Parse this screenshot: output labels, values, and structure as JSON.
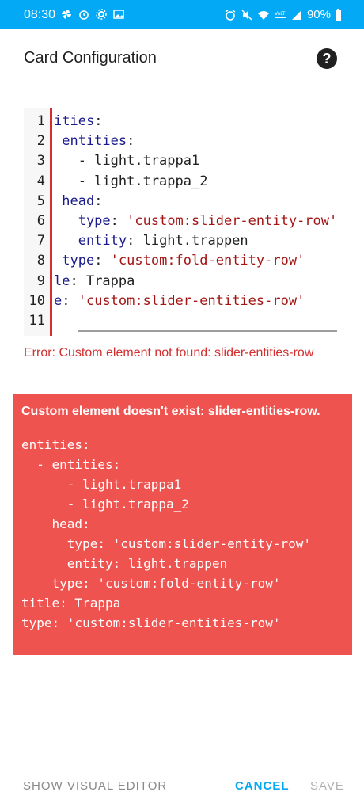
{
  "statusbar": {
    "time": "08:30",
    "battery": "90%",
    "icons_left": [
      "pinwheel-icon",
      "alarm-clock-icon",
      "gear-icon",
      "image-icon"
    ],
    "icons_right": [
      "alarm-icon",
      "mute-icon",
      "wifi-icon",
      "volte-icon",
      "signal-icon",
      "battery-icon"
    ]
  },
  "dialog": {
    "title": "Card Configuration",
    "help_icon": "?"
  },
  "editor": {
    "line_numbers": [
      "1",
      "2",
      "3",
      "4",
      "5",
      "6",
      "7",
      "8",
      "9",
      "10",
      "11"
    ],
    "lines": [
      [
        {
          "t": "ities",
          "c": "k"
        },
        {
          "t": ":",
          "c": "v"
        }
      ],
      [
        {
          "t": " entities",
          "c": "k"
        },
        {
          "t": ":",
          "c": "v"
        }
      ],
      [
        {
          "t": "   - light.trappa1",
          "c": "v"
        }
      ],
      [
        {
          "t": "   - light.trappa_2",
          "c": "v"
        }
      ],
      [
        {
          "t": " head",
          "c": "k"
        },
        {
          "t": ":",
          "c": "v"
        }
      ],
      [
        {
          "t": "   type",
          "c": "k"
        },
        {
          "t": ": ",
          "c": "v"
        },
        {
          "t": "'custom:slider-entity-row'",
          "c": "s"
        }
      ],
      [
        {
          "t": "   entity",
          "c": "k"
        },
        {
          "t": ": light.trappen",
          "c": "v"
        }
      ],
      [
        {
          "t": " type",
          "c": "k"
        },
        {
          "t": ": ",
          "c": "v"
        },
        {
          "t": "'custom:fold-entity-row'",
          "c": "s"
        }
      ],
      [
        {
          "t": "le",
          "c": "k"
        },
        {
          "t": ": Trappa",
          "c": "v"
        }
      ],
      [
        {
          "t": "e",
          "c": "k"
        },
        {
          "t": ": ",
          "c": "v"
        },
        {
          "t": "'custom:slider-entities-row'",
          "c": "s"
        }
      ],
      []
    ]
  },
  "error_message": "Error: Custom element not found: slider-entities-row",
  "error_card": {
    "title": "Custom element doesn't exist: slider-entities-row.",
    "yaml": "entities:\n  - entities:\n      - light.trappa1\n      - light.trappa_2\n    head:\n      type: 'custom:slider-entity-row'\n      entity: light.trappen\n    type: 'custom:fold-entity-row'\ntitle: Trappa\ntype: 'custom:slider-entities-row'"
  },
  "footer": {
    "show_visual_editor": "SHOW VISUAL EDITOR",
    "cancel": "CANCEL",
    "save": "SAVE"
  },
  "colors": {
    "statusbar": "#03a9f4",
    "accent": "#03a9f4",
    "error": "#d32f2f",
    "error_card": "#ef5350"
  }
}
